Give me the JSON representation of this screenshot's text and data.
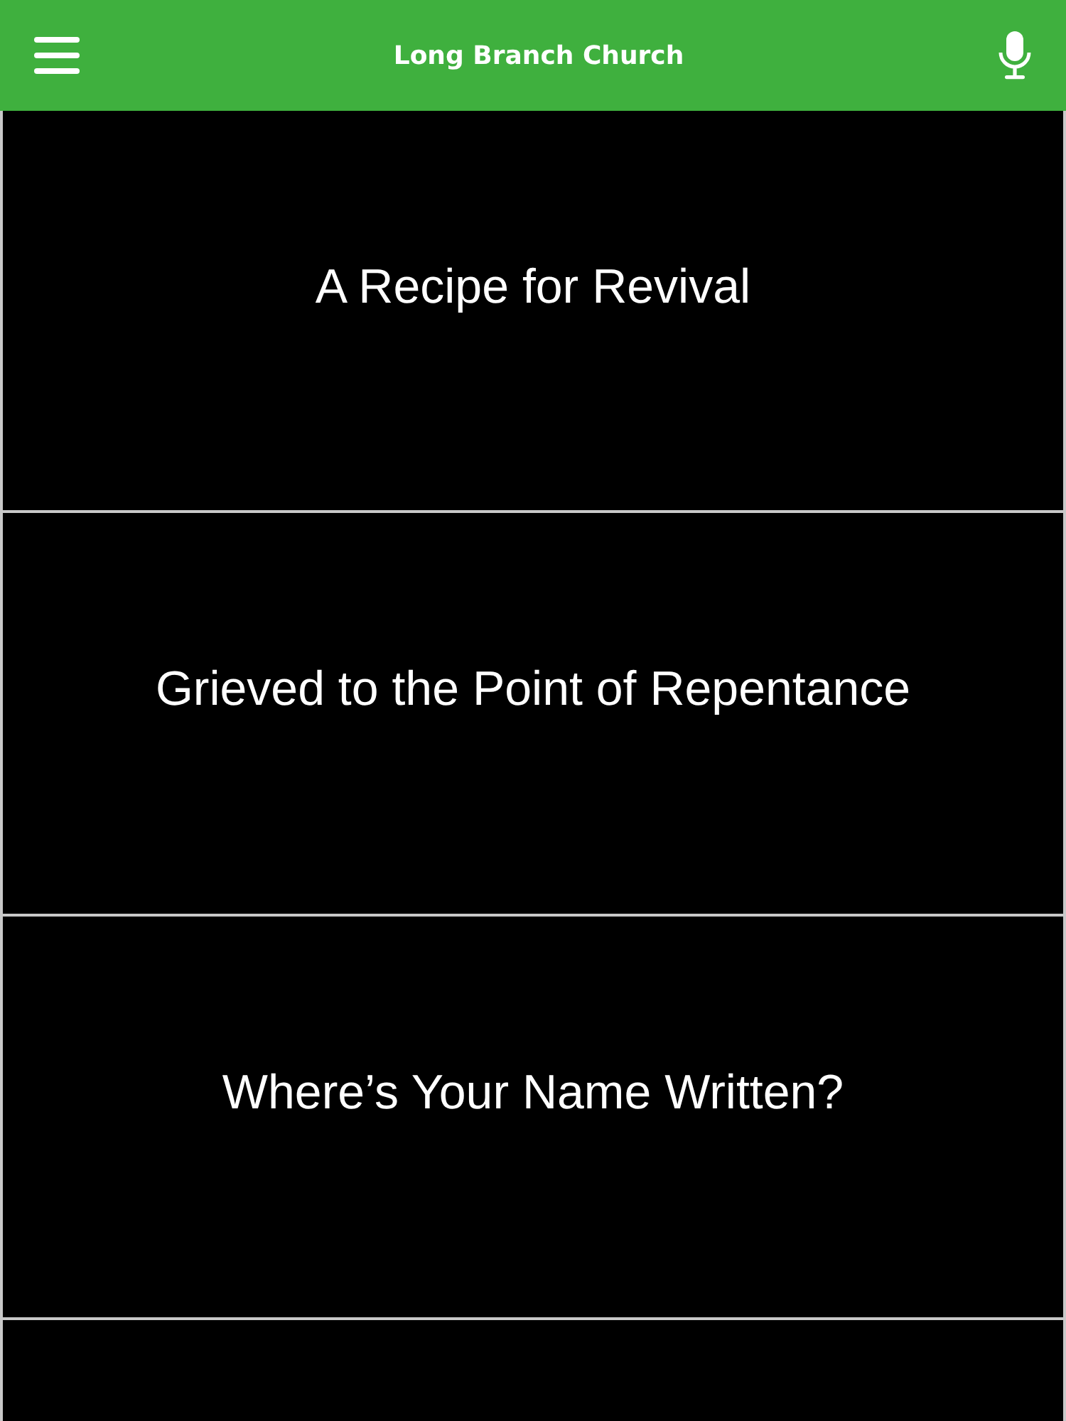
{
  "header": {
    "title": "Long Branch Church"
  },
  "items": [
    {
      "title": "A Recipe for Revival"
    },
    {
      "title": "Grieved to the Point of Repentance"
    },
    {
      "title": "Where’s Your Name Written?"
    }
  ]
}
